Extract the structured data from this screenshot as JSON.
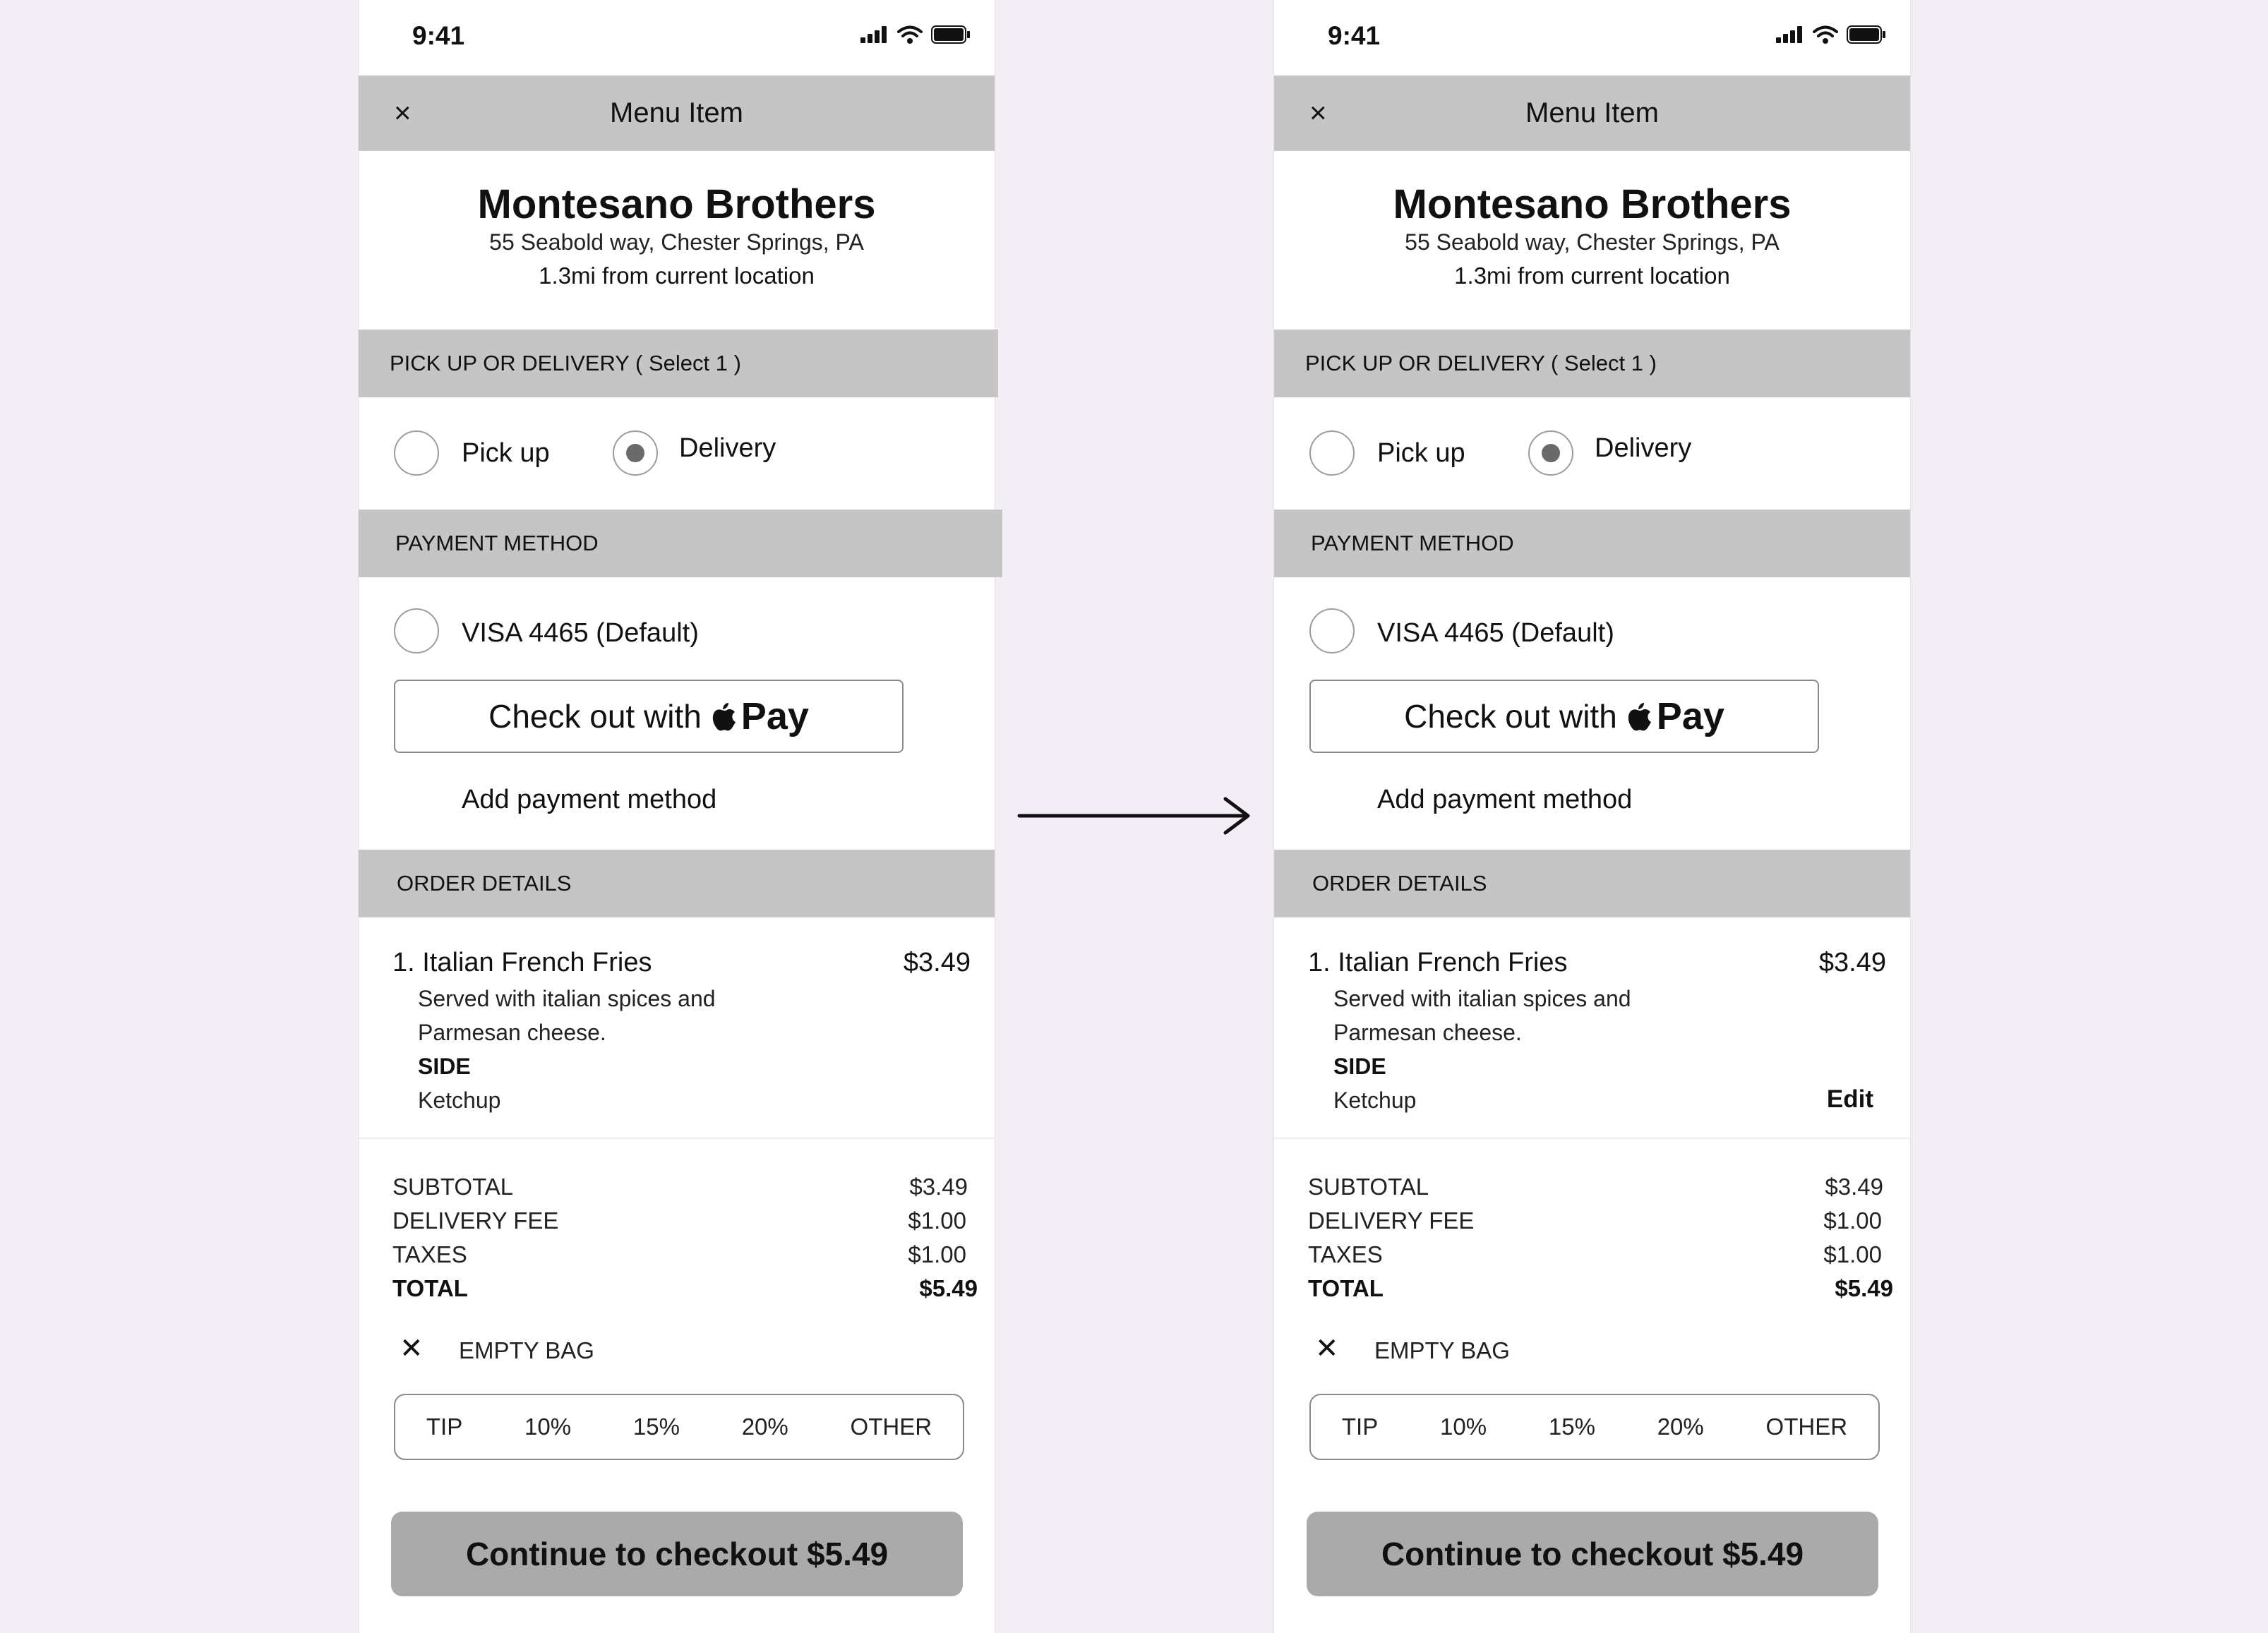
{
  "screens": [
    {
      "status": {
        "time": "9:41"
      },
      "header": {
        "close_icon": "×",
        "title": "Menu Item"
      },
      "restaurant": {
        "name": "Montesano Brothers",
        "address": "55 Seabold way, Chester Springs, PA",
        "distance": "1.3mi from current location"
      },
      "pickup_section": {
        "label": "PICK UP OR DELIVERY ( Select 1 )",
        "options": [
          "Pick up",
          "Delivery"
        ],
        "selected": "Delivery"
      },
      "payment_section": {
        "label": "PAYMENT METHOD",
        "card": "VISA 4465 (Default)",
        "checkout_prefix": "Check out with",
        "pay_brand": "Pay",
        "add_payment": "Add payment method"
      },
      "order_section": {
        "label": "ORDER DETAILS"
      },
      "item": {
        "title": "1. Italian French Fries",
        "price": "$3.49",
        "desc_line1": "Served with italian spices and",
        "desc_line2": "Parmesan cheese.",
        "side_label": "SIDE",
        "side_value": "Ketchup",
        "edit_label": ""
      },
      "summary": {
        "subtotal_label": "SUBTOTAL",
        "subtotal": "$3.49",
        "delivery_label": "DELIVERY FEE",
        "delivery": "$1.00",
        "taxes_label": "TAXES",
        "taxes": "$1.00",
        "total_label": "TOTAL",
        "total": "$5.49"
      },
      "empty_bag": {
        "icon": "✕",
        "label": "EMPTY BAG"
      },
      "tip_options": [
        "TIP",
        "10%",
        "15%",
        "20%",
        "OTHER"
      ],
      "checkout_label": "Continue to checkout $5.49"
    },
    {
      "status": {
        "time": "9:41"
      },
      "header": {
        "close_icon": "×",
        "title": "Menu Item"
      },
      "restaurant": {
        "name": "Montesano Brothers",
        "address": "55 Seabold way, Chester Springs, PA",
        "distance": "1.3mi from current location"
      },
      "pickup_section": {
        "label": "PICK UP OR DELIVERY ( Select 1 )",
        "options": [
          "Pick up",
          "Delivery"
        ],
        "selected": "Delivery"
      },
      "payment_section": {
        "label": "PAYMENT METHOD",
        "card": "VISA 4465 (Default)",
        "checkout_prefix": "Check out with",
        "pay_brand": "Pay",
        "add_payment": "Add payment method"
      },
      "order_section": {
        "label": "ORDER DETAILS"
      },
      "item": {
        "title": "1. Italian French Fries",
        "price": "$3.49",
        "desc_line1": "Served with italian spices and",
        "desc_line2": "Parmesan cheese.",
        "side_label": "SIDE",
        "side_value": "Ketchup",
        "edit_label": "Edit"
      },
      "summary": {
        "subtotal_label": "SUBTOTAL",
        "subtotal": "$3.49",
        "delivery_label": "DELIVERY FEE",
        "delivery": "$1.00",
        "taxes_label": "TAXES",
        "taxes": "$1.00",
        "total_label": "TOTAL",
        "total": "$5.49"
      },
      "empty_bag": {
        "icon": "✕",
        "label": "EMPTY BAG"
      },
      "tip_options": [
        "TIP",
        "10%",
        "15%",
        "20%",
        "OTHER"
      ],
      "checkout_label": "Continue to checkout $5.49"
    }
  ],
  "icons": {
    "status": [
      "signal-icon",
      "wifi-icon",
      "battery-icon"
    ],
    "pay_logo": "apple-logo-icon",
    "transition": "arrow-right-icon"
  },
  "colors": {
    "background": "#f3eef6",
    "header": "#c5c5c5",
    "button": "#aaaaaa"
  }
}
